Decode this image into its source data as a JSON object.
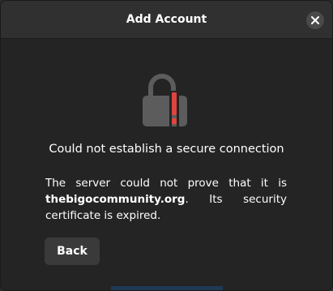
{
  "dialog": {
    "title": "Add Account",
    "close_icon": "close-icon",
    "lock_icon": "broken-lock-warning-icon",
    "heading": "Could not establish a secure connection",
    "message_prefix": "The server could not prove that it is",
    "domain": "thebigocommunity.org",
    "message_suffix": ". Its security certificate is expired.",
    "back_label": "Back"
  },
  "colors": {
    "background": "#242424",
    "titlebar": "#303030",
    "lock": "#5c5c5c",
    "warning": "#e0443e",
    "button": "#3a3a3a"
  }
}
